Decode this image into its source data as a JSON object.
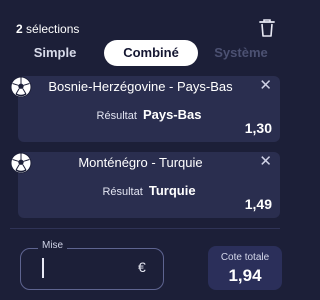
{
  "header": {
    "count": "2",
    "count_suffix": "sélections",
    "trash_icon": "trash-icon"
  },
  "tabs": [
    {
      "label": "Simple",
      "state": "inactive"
    },
    {
      "label": "Combiné",
      "state": "active"
    },
    {
      "label": "Système",
      "state": "disabled"
    }
  ],
  "selections": [
    {
      "match": "Bosnie-Herzégovine - Pays-Bas",
      "result_label": "Résultat",
      "pick": "Pays-Bas",
      "odd": "1,30",
      "sport_icon": "soccer-ball-icon"
    },
    {
      "match": "Monténégro - Turquie",
      "result_label": "Résultat",
      "pick": "Turquie",
      "odd": "1,49",
      "sport_icon": "soccer-ball-icon"
    }
  ],
  "stake": {
    "label": "Mise",
    "value": "",
    "currency": "€"
  },
  "total": {
    "label": "Cote totale",
    "value": "1,94"
  },
  "colors": {
    "background": "#1c1f38",
    "card": "#2a2e4f",
    "active_tab": "#ffffff",
    "total_box": "#2b2f5a"
  }
}
